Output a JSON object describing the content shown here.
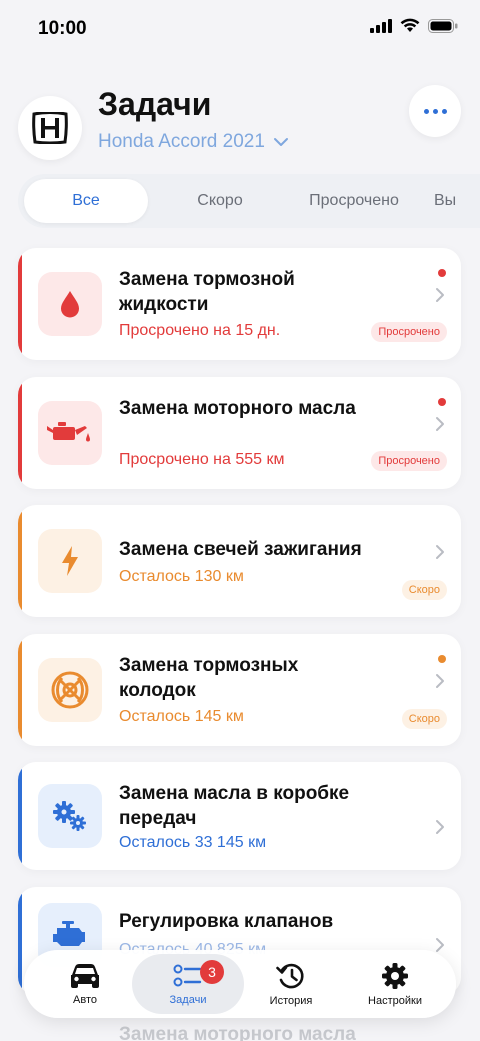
{
  "status_bar": {
    "time": "10:00"
  },
  "header": {
    "title": "Задачи",
    "car_name": "Honda Accord 2021",
    "brand_logo": "honda-logo",
    "more_icon": "more-horizontal-icon"
  },
  "tabs": [
    {
      "label": "Все",
      "active": true
    },
    {
      "label": "Скоро",
      "active": false
    },
    {
      "label": "Просрочено",
      "active": false
    },
    {
      "label": "Вы",
      "active": false
    }
  ],
  "tasks": [
    {
      "title": "Замена тормозной жидкости",
      "status": "Просрочено на 15 дн.",
      "badge": "Просрочено",
      "icon": "brake-fluid-drop-icon",
      "state": "overdue",
      "dot": true
    },
    {
      "title": "Замена моторного масла",
      "status": "Просрочено на 555 км",
      "badge": "Просрочено",
      "icon": "oil-can-icon",
      "state": "overdue",
      "dot": true
    },
    {
      "title": "Замена свечей зажигания",
      "status": "Осталось 130 км",
      "badge": "Скоро",
      "icon": "lightning-icon",
      "state": "soon",
      "dot": false
    },
    {
      "title": "Замена тормозных колодок",
      "status": "Осталось 145 км",
      "badge": "Скоро",
      "icon": "brake-disc-icon",
      "state": "soon",
      "dot": true
    },
    {
      "title": "Замена масла в коробке передач",
      "status": "Осталось 33 145 км",
      "badge": "",
      "icon": "gears-icon",
      "state": "ok",
      "dot": false
    },
    {
      "title": "Регулировка клапанов",
      "status": "Осталось 40 825 км",
      "badge": "",
      "icon": "engine-icon",
      "state": "ok",
      "dot": false
    }
  ],
  "faded_next_title": "Замена моторного масла",
  "bottom_nav": [
    {
      "label": "Авто",
      "icon": "car-icon",
      "active": false
    },
    {
      "label": "Задачи",
      "icon": "tasks-list-icon",
      "active": true,
      "badge": "3"
    },
    {
      "label": "История",
      "icon": "history-clock-icon",
      "active": false
    },
    {
      "label": "Настройки",
      "icon": "gear-icon",
      "active": false
    }
  ],
  "colors": {
    "overdue": "#e23b3b",
    "overdue_bg": "#fde8e8",
    "soon": "#e98b2f",
    "soon_bg": "#fdf1e4",
    "ok": "#2f6fd6",
    "ok_bg": "#e6effc",
    "accent": "#2f6fd6"
  }
}
